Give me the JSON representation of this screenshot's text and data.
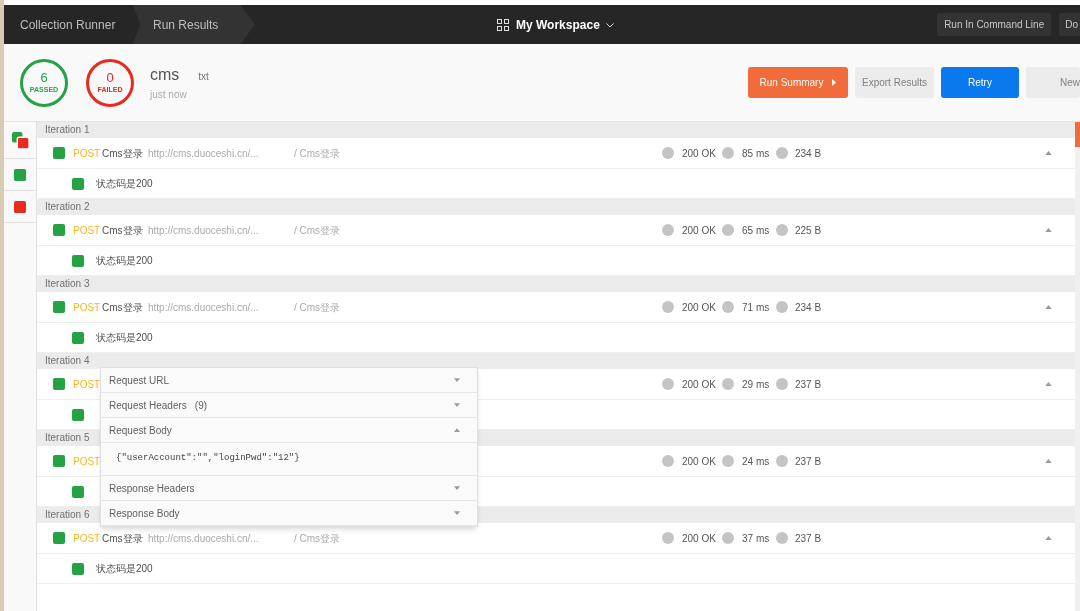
{
  "top_bar": {
    "breadcrumbs": [
      {
        "label": "Collection Runner",
        "selected": false
      },
      {
        "label": "Run Results",
        "selected": true
      }
    ],
    "workspace": "My Workspace",
    "buttons": [
      "Run In Command Line",
      "Do"
    ]
  },
  "summary": {
    "passed": {
      "count": "6",
      "label": "PASSED"
    },
    "failed": {
      "count": "0",
      "label": "FAILED"
    },
    "name": "cms",
    "environment": "txt",
    "time": "just now",
    "actions": [
      {
        "label": "Run Summary",
        "kind": "primary"
      },
      {
        "label": "Export Results",
        "kind": "plain"
      },
      {
        "label": "Retry",
        "kind": "accent"
      },
      {
        "label": "New",
        "kind": "plain"
      }
    ]
  },
  "filters": [
    {
      "kind": "all"
    },
    {
      "kind": "passed"
    },
    {
      "kind": "failed"
    }
  ],
  "iterations": [
    {
      "label": "Iteration 1",
      "request": {
        "method": "POST",
        "name": "Cms登录",
        "url": "http://cms.duoceshi.cn/...",
        "path": "/ Cms登录",
        "status": "200 OK",
        "time": "85 ms",
        "size": "234 B",
        "expanded": true
      },
      "tests": [
        {
          "name": "状态码是200",
          "passed": true
        }
      ]
    },
    {
      "label": "Iteration 2",
      "request": {
        "method": "POST",
        "name": "Cms登录",
        "url": "http://cms.duoceshi.cn/...",
        "path": "/ Cms登录",
        "status": "200 OK",
        "time": "65 ms",
        "size": "225 B",
        "expanded": true
      },
      "tests": [
        {
          "name": "状态码是200",
          "passed": true
        }
      ]
    },
    {
      "label": "Iteration 3",
      "request": {
        "method": "POST",
        "name": "Cms登录",
        "url": "http://cms.duoceshi.cn/...",
        "path": "/ Cms登录",
        "status": "200 OK",
        "time": "71 ms",
        "size": "234 B",
        "expanded": true
      },
      "tests": [
        {
          "name": "状态码是200",
          "passed": true
        }
      ]
    },
    {
      "label": "Iteration 4",
      "request": {
        "method": "POST",
        "status": "200 OK",
        "time": "29 ms",
        "size": "237 B",
        "expanded": true
      },
      "tests": [
        {
          "passed": true
        }
      ]
    },
    {
      "label": "Iteration 5",
      "request": {
        "method": "POST",
        "status": "200 OK",
        "time": "24 ms",
        "size": "237 B",
        "expanded": true
      },
      "tests": [
        {
          "passed": true
        }
      ]
    },
    {
      "label": "Iteration 6",
      "request": {
        "method": "POST",
        "name": "Cms登录",
        "url": "http://cms.duoceshi.cn/...",
        "path": "/ Cms登录",
        "status": "200 OK",
        "time": "37 ms",
        "size": "237 B",
        "expanded": true
      },
      "tests": [
        {
          "name": "状态码是200",
          "passed": true
        }
      ]
    }
  ],
  "request_popup": {
    "sections": [
      {
        "label": "Request URL",
        "expanded": false
      },
      {
        "label": "Request Headers",
        "count": "(9)",
        "expanded": false
      },
      {
        "label": "Request Body",
        "expanded": true,
        "body": "{\"userAccount\":\"\",\"loginPwd\":\"12\"}"
      },
      {
        "label": "Response Headers",
        "expanded": false
      },
      {
        "label": "Response Body",
        "expanded": false
      }
    ]
  }
}
